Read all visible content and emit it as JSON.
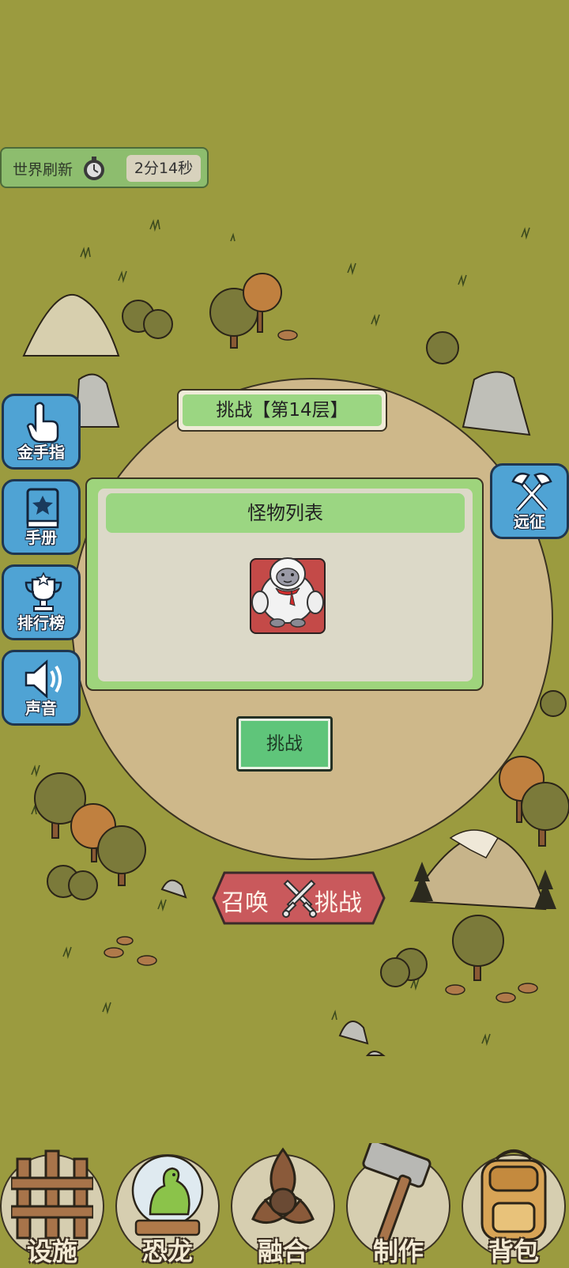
{
  "timer": {
    "label": "世界刷新",
    "icon": "stopwatch-icon",
    "value": "2分14秒"
  },
  "challenge": {
    "title": "挑战【第14层】",
    "panel_title": "怪物列表",
    "monster": "yeti-monster-icon",
    "button_label": "挑战"
  },
  "summon": {
    "left": "召唤",
    "right": "挑战",
    "icon": "crossed-swords-icon"
  },
  "side_left": [
    {
      "label": "金手指",
      "icon": "pointing-hand-icon"
    },
    {
      "label": "手册",
      "icon": "star-book-icon"
    },
    {
      "label": "排行榜",
      "icon": "trophy-icon"
    },
    {
      "label": "声音",
      "icon": "speaker-icon"
    }
  ],
  "side_right": [
    {
      "label": "远征",
      "icon": "crossed-axes-icon"
    }
  ],
  "nav": [
    {
      "label": "设施",
      "icon": "fence-icon"
    },
    {
      "label": "恐龙",
      "icon": "dinosaur-globe-icon"
    },
    {
      "label": "融合",
      "icon": "triquetra-icon"
    },
    {
      "label": "制作",
      "icon": "hammer-icon"
    },
    {
      "label": "背包",
      "icon": "backpack-icon"
    }
  ],
  "colors": {
    "background": "#9b9b3f",
    "arena": "#ceb88a",
    "panel_green": "#9bd682",
    "side_button": "#4fa3d4",
    "summon": "#c9595c",
    "challenge_button": "#5fc57a"
  }
}
